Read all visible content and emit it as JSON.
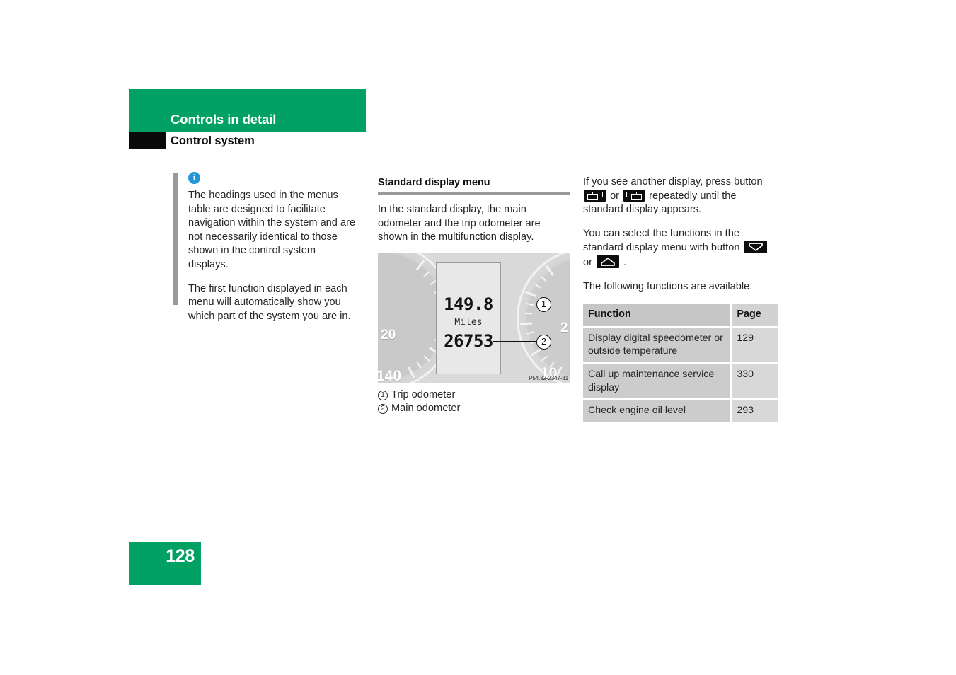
{
  "header": {
    "chapter_title": "Controls in detail",
    "section_title": "Control system"
  },
  "note": {
    "icon": "info-icon",
    "paragraphs": [
      "The headings used in the menus table are designed to facilitate navigation within the system and are not necessarily identical to those shown in the control system displays.",
      "The first function displayed in each menu will automatically show you which part of the system you are in."
    ]
  },
  "middle": {
    "heading": "Standard display menu",
    "intro": "In the standard display, the main odometer and the trip odometer are shown in the multifunction display.",
    "illustration": {
      "trip_value": "149.8",
      "unit": "Miles",
      "main_value": "26753",
      "dial_left_labels": [
        "20",
        "140"
      ],
      "dial_right_labels": [
        "2",
        "10"
      ],
      "callouts": [
        "1",
        "2"
      ],
      "image_id": "P54.32-2347-31"
    },
    "legend": [
      {
        "marker": "1",
        "label": "Trip odometer"
      },
      {
        "marker": "2",
        "label": "Main odometer"
      }
    ]
  },
  "right": {
    "para1_part1": "If you see another display, press button",
    "para1_or": "or",
    "para1_part2": "repeatedly until the standard display appears.",
    "para2_part1": "You can select the functions in the standard display menu with button",
    "para2_or": "or",
    "para2_end": ".",
    "para3": "The following functions are available:",
    "buttons": {
      "prev_display": "display-prev-button-icon",
      "next_display": "display-next-button-icon",
      "down": "arrow-down-button-icon",
      "up": "arrow-up-button-icon"
    },
    "table": {
      "headers": [
        "Function",
        "Page"
      ],
      "rows": [
        {
          "function": "Display digital speedometer or outside temperature",
          "page": "129"
        },
        {
          "function": "Call up maintenance service display",
          "page": "330"
        },
        {
          "function": "Check engine oil level",
          "page": "293"
        }
      ]
    }
  },
  "footer": {
    "page_number": "128"
  },
  "colors": {
    "brand_green": "#00a163",
    "info_blue": "#2196d9",
    "rule_gray": "#9a9a9a",
    "table_row": "#cccccc",
    "table_header": "#c6c6c6"
  }
}
